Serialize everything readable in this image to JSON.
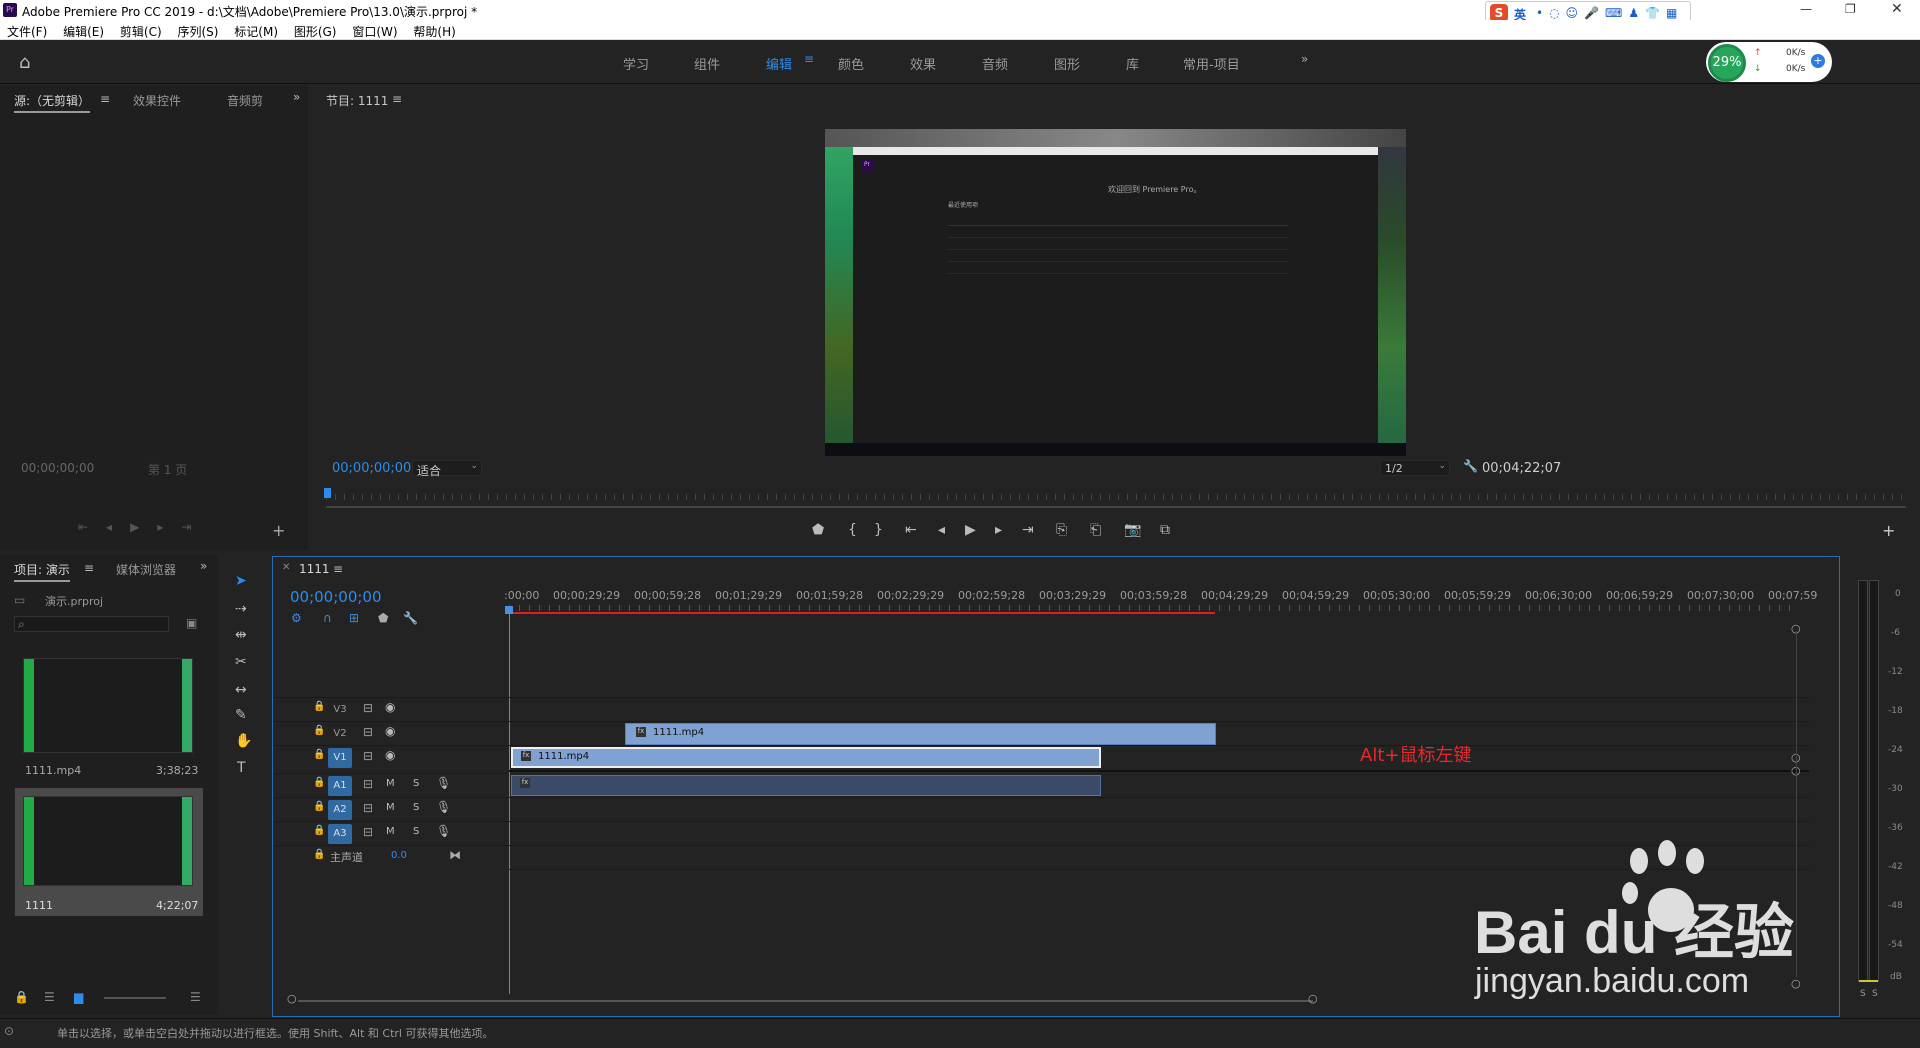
{
  "window": {
    "title": "Adobe Premiere Pro CC 2019 - d:\\文档\\Adobe\\Premiere Pro\\13.0\\演示.prproj *",
    "ime_label": "英"
  },
  "menu": [
    "文件(F)",
    "编辑(E)",
    "剪辑(C)",
    "序列(S)",
    "标记(M)",
    "图形(G)",
    "窗口(W)",
    "帮助(H)"
  ],
  "workspace_tabs": [
    "学习",
    "组件",
    "编辑",
    "颜色",
    "效果",
    "音频",
    "图形",
    "库",
    "常用-项目"
  ],
  "active_workspace": "编辑",
  "network_widget": {
    "percent": "29%",
    "up": "0K/s",
    "down": "0K/s"
  },
  "source_panel": {
    "tabs": [
      "源:（无剪辑）",
      "效果控件",
      "音频剪"
    ],
    "timecode": "00;00;00;00",
    "page": "第 1 页"
  },
  "program_panel": {
    "title": "节目: 1111",
    "timecode": "00;00;00;00",
    "fit": "适合",
    "resolution": "1/2",
    "duration": "00;04;22;07"
  },
  "preview": {
    "welcome": "欢迎回到 Premiere Pro。",
    "recent": "最近使用项"
  },
  "project_panel": {
    "tabs": [
      "项目: 演示",
      "媒体浏览器"
    ],
    "project_file": "演示.prproj",
    "items": [
      {
        "name": "1111.mp4",
        "duration": "3;38;23"
      },
      {
        "name": "1111",
        "duration": "4;22;07"
      }
    ]
  },
  "timeline": {
    "sequence_tab": "1111",
    "timecode": "00;00;00;00",
    "ruler_labels": [
      ":00;00",
      "00;00;29;29",
      "00;00;59;28",
      "00;01;29;29",
      "00;01;59;28",
      "00;02;29;29",
      "00;02;59;28",
      "00;03;29;29",
      "00;03;59;28",
      "00;04;29;29",
      "00;04;59;29",
      "00;05;30;00",
      "00;05;59;29",
      "00;06;30;00",
      "00;06;59;29",
      "00;07;30;00",
      "00;07;59"
    ],
    "video_tracks": [
      "V3",
      "V2",
      "V1"
    ],
    "audio_tracks": [
      "A1",
      "A2",
      "A3"
    ],
    "track_m": "M",
    "track_s": "S",
    "master_label": "主声道",
    "master_value": "0.0",
    "clip_v2": "1111.mp4",
    "clip_v1": "1111.mp4",
    "annotation": "Alt+鼠标左键"
  },
  "vu_meter": {
    "labels": [
      "0",
      "-6",
      "-12",
      "-18",
      "-24",
      "-30",
      "-36",
      "-42",
      "-48",
      "-54",
      "dB"
    ],
    "solo": [
      "S",
      "S"
    ]
  },
  "status_bar": "单击以选择，或单击空白处并拖动以进行框选。使用 Shift、Alt 和 Ctrl 可获得其他选项。",
  "watermark": {
    "brand": "Bai du 经验",
    "url": "jingyan.baidu.com"
  },
  "colors": {
    "accent": "#2d8ceb",
    "playhead": "#4a90e2",
    "annotation": "#e8282b",
    "clip": "#7fa2d3"
  }
}
